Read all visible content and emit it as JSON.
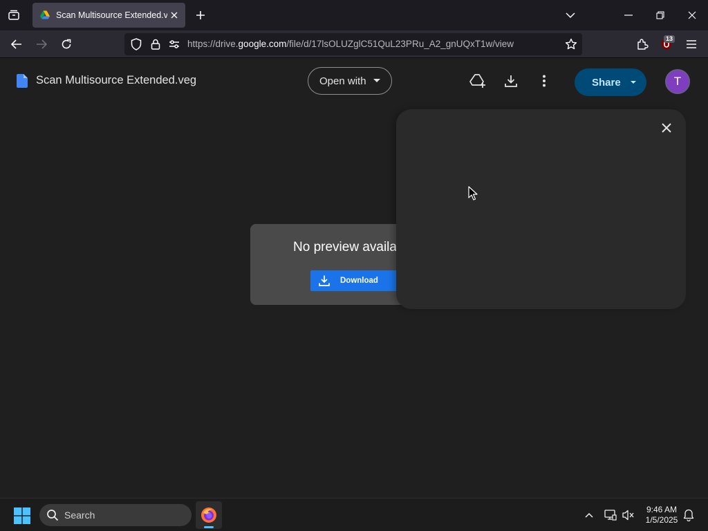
{
  "browser": {
    "tab": {
      "title": "Scan Multisource Extended.veg",
      "favicon": "google-drive-icon"
    },
    "url": {
      "prefix": "https://drive.",
      "host": "google.com",
      "path": "/file/d/17lsOLUZglC51QuL23PRu_A2_gnUQxT1w/view"
    },
    "extension_badge": "13"
  },
  "viewer": {
    "file_title": "Scan Multisource Extended.veg",
    "open_with_label": "Open with",
    "share_label": "Share",
    "avatar_letter": "T"
  },
  "preview": {
    "message": "No preview available",
    "download_label": "Download"
  },
  "taskbar": {
    "search_label": "Search",
    "time": "9:46 AM",
    "date": "1/5/2025"
  },
  "colors": {
    "page_bg": "#1f1f1f",
    "share_bg": "#004a77",
    "share_text": "#c2e7ff",
    "download_btn": "#1a73e8",
    "avatar_bg": "#7e3ebf",
    "panel_bg": "#2a2a2a"
  }
}
